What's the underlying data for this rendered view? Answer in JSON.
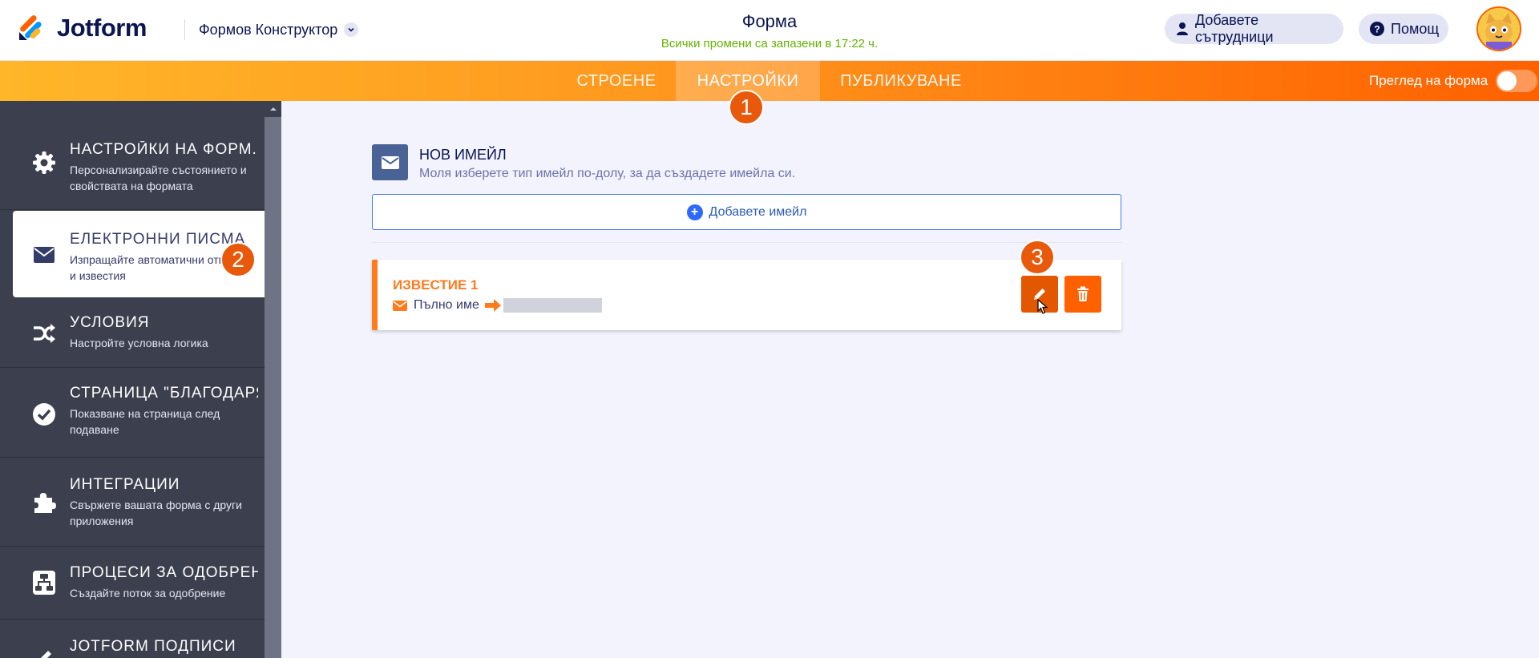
{
  "header": {
    "logo_text": "Jotform",
    "builder_label": "Формов Конструктор",
    "form_title": "Форма",
    "saved_status": "Всички промени са запазени в 17:22 ч.",
    "add_collaborators": "Добавете сътрудници",
    "help": "Помощ"
  },
  "nav": {
    "tabs": [
      {
        "label": "СТРОЕНЕ"
      },
      {
        "label": "НАСТРОЙКИ"
      },
      {
        "label": "ПУБЛИКУВАНЕ"
      }
    ],
    "preview_label": "Преглед на форма",
    "preview_enabled": false
  },
  "badges": [
    "1",
    "2",
    "3"
  ],
  "sidebar": {
    "items": [
      {
        "title": "НАСТРОЙКИ НА ФОРМ...",
        "desc": "Персонализирайте състоянието и свойствата на формата"
      },
      {
        "title": "ЕЛЕКТРОННИ ПИСМА",
        "desc": "Изпращайте автоматични отговори и известия"
      },
      {
        "title": "УСЛОВИЯ",
        "desc": "Настройте условна логика"
      },
      {
        "title": "СТРАНИЦА \"БЛАГОДАРЯ\"",
        "desc": "Показване на страница след подаване"
      },
      {
        "title": "ИНТЕГРАЦИИ",
        "desc": "Свържете вашата форма с други приложения"
      },
      {
        "title": "ПРОЦЕСИ ЗА ОДОБРЕН...",
        "desc": "Създайте поток за одобрение"
      },
      {
        "title": "JOTFORM ПОДПИСИ",
        "desc": ""
      }
    ]
  },
  "main": {
    "new_email_title": "НОВ ИМЕЙЛ",
    "new_email_desc": "Моля изберете тип имейл по-долу, за да създадете имейла си.",
    "add_email_button": "Добавете имейл",
    "notification": {
      "title": "ИЗВЕСТИЕ 1",
      "field_label": "Пълно име"
    }
  },
  "colors": {
    "accent_orange": "#ff6100",
    "sidebar_bg": "#3c3f4d",
    "link_blue": "#2e69ff",
    "saved_green": "#64b200"
  }
}
